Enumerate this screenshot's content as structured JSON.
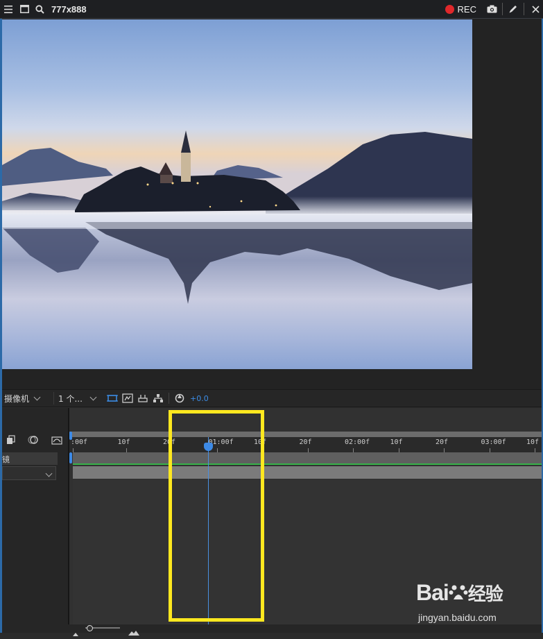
{
  "topbar": {
    "title": "777x888",
    "rec_label": "REC",
    "icons": [
      "menu-icon",
      "window-icon",
      "search-icon",
      "record-icon",
      "camera-icon",
      "pen-icon",
      "close-icon"
    ]
  },
  "viewer": {
    "image_subject": "lake-church-island-photo"
  },
  "comp_bar": {
    "camera_select": "摄像机",
    "view_select": "1 个...",
    "exposure_value": "+0.0"
  },
  "timeline": {
    "ruler_labels": [
      ":00f",
      "10f",
      "20f",
      "01:00f",
      "10f",
      "20f",
      "02:00f",
      "10f",
      "20f",
      "03:00f",
      "10f"
    ],
    "layer_label": "镜",
    "playhead_time": "01:00f"
  },
  "watermark": {
    "brand": "Bai",
    "brand_cn": "经验",
    "url": "jingyan.baidu.com"
  },
  "colors": {
    "highlight": "#ffe81f",
    "playhead": "#3d8ae6",
    "record": "#e0282b",
    "track_green": "#38b34a"
  }
}
